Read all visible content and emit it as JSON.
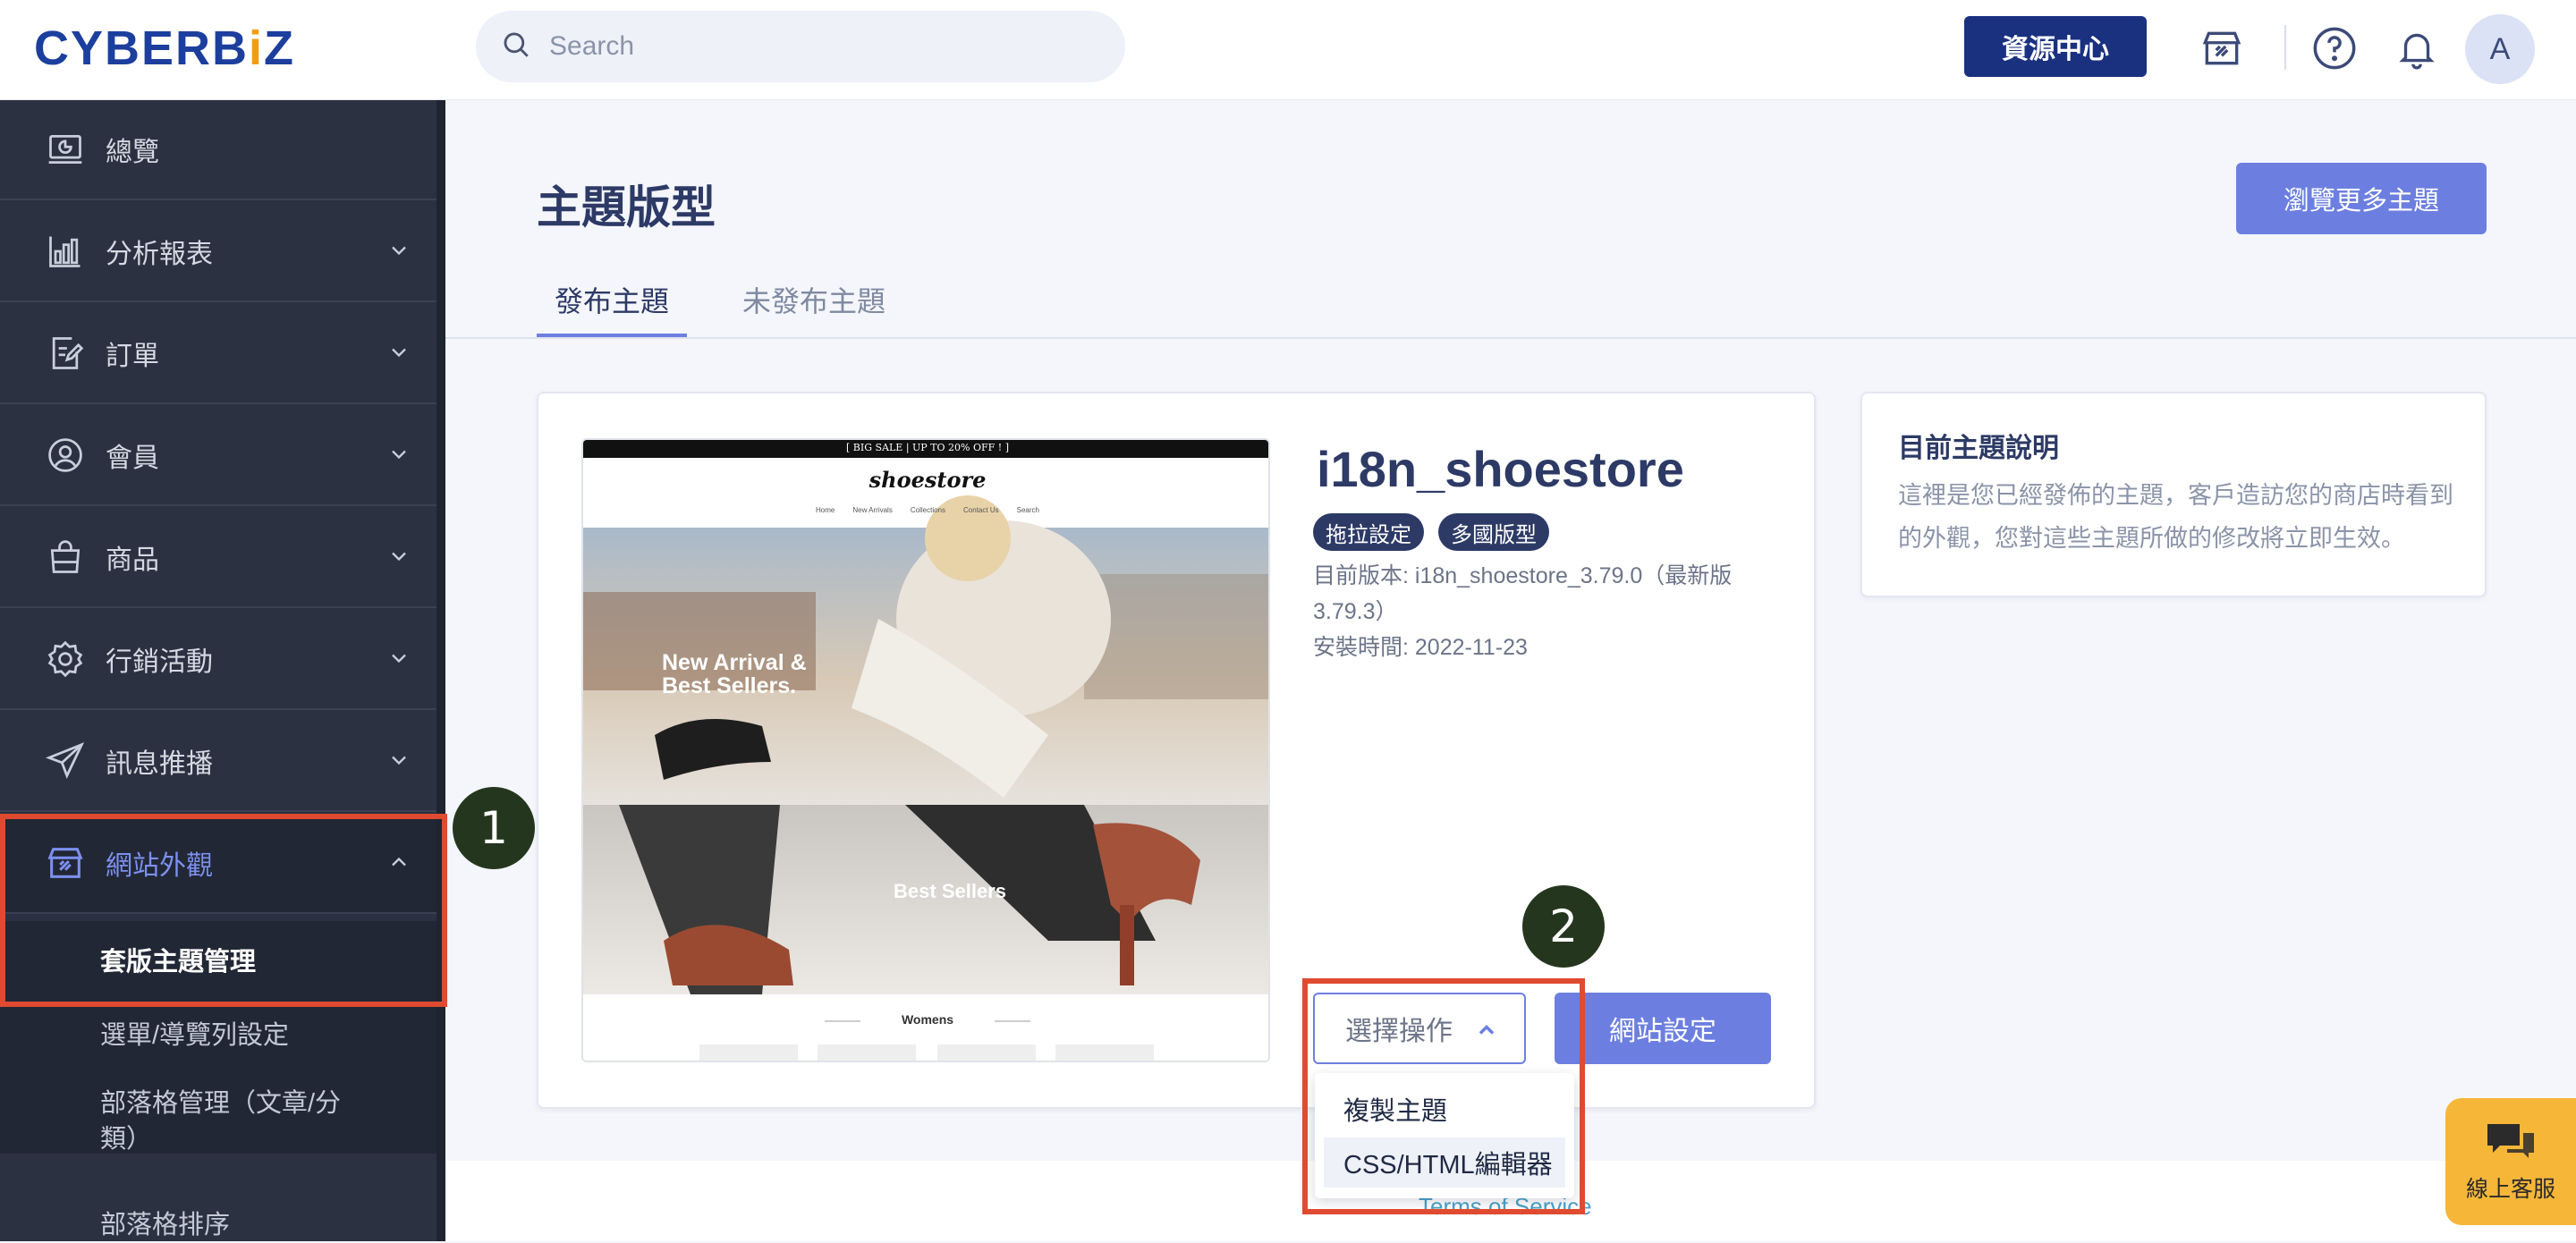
{
  "brand": {
    "logo_text": "CYBERB",
    "logo_dot": "i",
    "logo_tail": "Z"
  },
  "search": {
    "placeholder": "Search",
    "value": ""
  },
  "header": {
    "resource_button": "資源中心",
    "avatar_initial": "A"
  },
  "sidebar": {
    "items": [
      {
        "label": "總覽",
        "icon": "dashboard-icon",
        "expandable": false
      },
      {
        "label": "分析報表",
        "icon": "bar-chart-icon",
        "expandable": true
      },
      {
        "label": "訂單",
        "icon": "order-edit-icon",
        "expandable": true
      },
      {
        "label": "會員",
        "icon": "user-circle-icon",
        "expandable": true
      },
      {
        "label": "商品",
        "icon": "shopping-bag-icon",
        "expandable": true
      },
      {
        "label": "行銷活動",
        "icon": "gear-badge-icon",
        "expandable": true
      },
      {
        "label": "訊息推播",
        "icon": "send-icon",
        "expandable": true
      },
      {
        "label": "網站外觀",
        "icon": "storefront-icon",
        "expandable": true,
        "expanded": true
      }
    ],
    "subitems": [
      {
        "label": "套版主題管理",
        "current": true
      },
      {
        "label": "選單/導覽列設定",
        "current": false
      },
      {
        "label": "部落格管理（文章/分類）",
        "current": false
      },
      {
        "label": "部落格排序",
        "current": false
      }
    ]
  },
  "main": {
    "page_title": "主題版型",
    "browse_button": "瀏覽更多主題",
    "tabs": [
      {
        "label": "發布主題",
        "active": true
      },
      {
        "label": "未發布主題",
        "active": false
      }
    ],
    "theme": {
      "name": "i18n_shoestore",
      "tags": [
        "拖拉設定",
        "多國版型"
      ],
      "version_line1": "目前版本: i18n_shoestore_3.79.0（最新版",
      "version_line2": "3.79.3）",
      "installed": "安裝時間: 2022-11-23",
      "preview": {
        "banner": "[ BIG SALE | UP TO 20% OFF ! ]",
        "store_name": "shoestore",
        "nav": [
          "Home",
          "New Arrivals",
          "Collections",
          "Contact Us",
          "Search"
        ],
        "hero_text_1": "New Arrival &",
        "hero_text_2": "Best Sellers.",
        "section_title": "Best Sellers",
        "footer_label": "Womens"
      }
    },
    "select_label": "選擇操作",
    "site_settings_button": "網站設定",
    "dropdown_options": [
      "複製主題",
      "CSS/HTML編輯器"
    ],
    "info": {
      "title": "目前主題說明",
      "description": "這裡是您已經發佈的主題，客戶造訪您的商店時看到的外觀，您對這些主題所做的修改將立即生效。"
    },
    "footer_link": "Terms of Service"
  },
  "annotations": {
    "step1": "1",
    "step2": "2"
  },
  "chat": {
    "label": "線上客服"
  },
  "colors": {
    "accent": "#6c7fe0",
    "navy": "#1a3180",
    "sidebar": "#2b3140",
    "highlight": "#e04a30",
    "chat": "#f6b638"
  }
}
